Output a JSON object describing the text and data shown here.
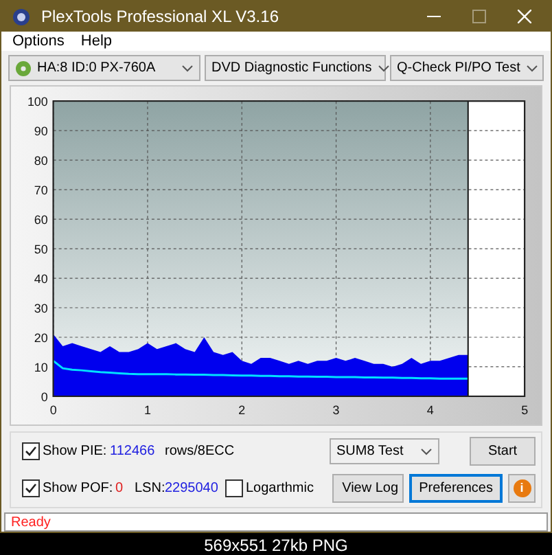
{
  "window": {
    "title": "PlexTools Professional XL V3.16"
  },
  "menu": [
    {
      "label": "Options"
    },
    {
      "label": "Help"
    }
  ],
  "toolbar": {
    "drive": "HA:8 ID:0  PX-760A",
    "function": "DVD Diagnostic Functions",
    "test": "Q-Check PI/PO Test"
  },
  "chart": {
    "chart_data": {
      "type": "area",
      "grid": true,
      "bands": [
        {
          "axis": "x",
          "from": 0,
          "to": 4.4
        }
      ],
      "ref_lines": [
        {
          "axis": "x",
          "value": 4.4,
          "color": "#111111"
        }
      ],
      "xlim": [
        0,
        5
      ],
      "ylim": [
        0,
        100
      ],
      "xticks": [
        0,
        1,
        2,
        3,
        4,
        5
      ],
      "yticks": [
        0,
        10,
        20,
        30,
        40,
        50,
        60,
        70,
        80,
        90,
        100
      ],
      "x": [
        0,
        0.1,
        0.2,
        0.3,
        0.4,
        0.5,
        0.6,
        0.7,
        0.8,
        0.9,
        1,
        1.1,
        1.2,
        1.3,
        1.4,
        1.5,
        1.6,
        1.7,
        1.8,
        1.9,
        2,
        2.1,
        2.2,
        2.3,
        2.4,
        2.5,
        2.6,
        2.7,
        2.8,
        2.9,
        3,
        3.1,
        3.2,
        3.3,
        3.4,
        3.5,
        3.6,
        3.7,
        3.8,
        3.9,
        4,
        4.1,
        4.2,
        4.3,
        4.4
      ],
      "series": [
        {
          "type": "area",
          "color": "#0000ee",
          "values": [
            21,
            17,
            18,
            17,
            16,
            15,
            17,
            15,
            15,
            16,
            18,
            16,
            17,
            18,
            16,
            15,
            20,
            15,
            14,
            15,
            12,
            11,
            13,
            13,
            12,
            11,
            12,
            11,
            12,
            12,
            13,
            12,
            13,
            12,
            11,
            11,
            10,
            11,
            13,
            11,
            12,
            12,
            13,
            14,
            14
          ]
        },
        {
          "type": "line",
          "color": "#00e0ff",
          "values": [
            12,
            9.5,
            9,
            8.8,
            8.5,
            8.2,
            8,
            7.8,
            7.6,
            7.5,
            7.5,
            7.5,
            7.5,
            7.4,
            7.4,
            7.3,
            7.3,
            7.2,
            7.2,
            7.1,
            7,
            7,
            6.9,
            6.9,
            6.8,
            6.8,
            6.7,
            6.7,
            6.6,
            6.6,
            6.5,
            6.5,
            6.5,
            6.4,
            6.4,
            6.3,
            6.3,
            6.2,
            6.2,
            6.1,
            6.1,
            6,
            6,
            6,
            6
          ]
        }
      ]
    }
  },
  "controls": {
    "show_pie": {
      "label": "Show PIE:",
      "checked": true,
      "value": "112466",
      "unit": "rows/8ECC"
    },
    "show_pof": {
      "label": "Show POF:",
      "checked": true,
      "value": "0"
    },
    "lsn": {
      "label": "LSN:",
      "value": "2295040"
    },
    "logarithmic": {
      "label": "Logarthmic",
      "checked": false
    },
    "test_select": {
      "value": "SUM8 Test"
    },
    "buttons": [
      {
        "label": "Start",
        "kind": "plain"
      },
      {
        "label": "View Log",
        "kind": "plain"
      },
      {
        "label": "Preferences",
        "kind": "default"
      },
      {
        "label": "i",
        "kind": "info"
      }
    ]
  },
  "status_bar": {
    "text": "Ready"
  },
  "caption": "569x551 27kb PNG"
}
